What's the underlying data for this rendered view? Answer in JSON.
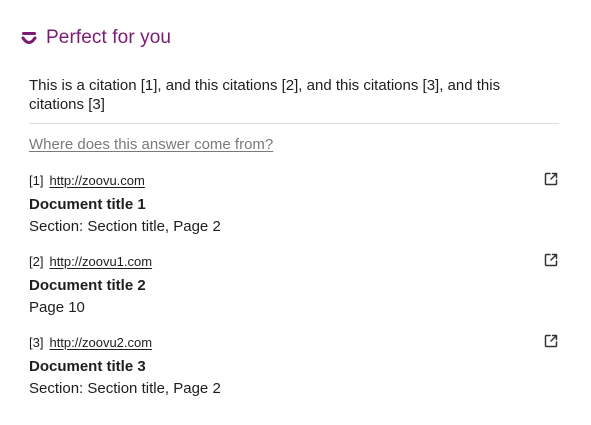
{
  "header": {
    "icon": "smile-logo-icon",
    "title": "Perfect for you",
    "accent_color": "#7a1a73"
  },
  "answer": {
    "text": "This is a citation [1], and this citations [2], and this citations [3], and this citations [3]"
  },
  "sources": {
    "question": "Where does this answer come from?",
    "items": [
      {
        "number": "[1]",
        "url": "http://zoovu.com",
        "title": "Document title 1",
        "section": "Section: Section title, Page 2",
        "icon": "external-link-icon"
      },
      {
        "number": "[2]",
        "url": "http://zoovu1.com",
        "title": "Document title 2",
        "section": "Page 10",
        "icon": "external-link-icon"
      },
      {
        "number": "[3]",
        "url": "http://zoovu2.com",
        "title": "Document title 3",
        "section": "Section: Section title, Page 2",
        "icon": "external-link-icon"
      }
    ]
  }
}
